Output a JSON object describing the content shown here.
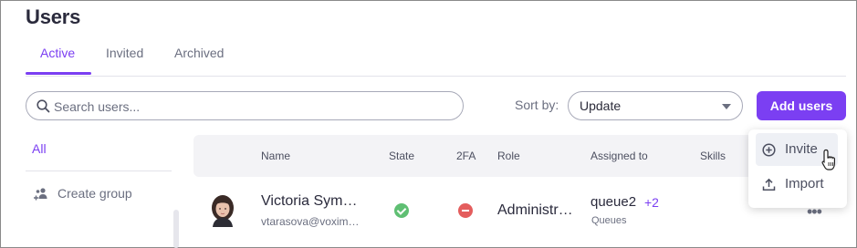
{
  "page": {
    "title": "Users"
  },
  "tabs": [
    {
      "label": "Active",
      "active": true
    },
    {
      "label": "Invited",
      "active": false
    },
    {
      "label": "Archived",
      "active": false
    }
  ],
  "toolbar": {
    "search_placeholder": "Search users...",
    "sort_label": "Sort by:",
    "sort_value": "Update",
    "add_label": "Add users"
  },
  "sidebar": {
    "all_label": "All",
    "create_group_label": "Create group"
  },
  "table": {
    "columns": [
      "Name",
      "State",
      "2FA",
      "Role",
      "Assigned to",
      "Skills"
    ],
    "rows": [
      {
        "name": "Victoria Sym…",
        "email": "vtarasova@voxim…",
        "state_icon": "check-circle-icon",
        "twofa_icon": "minus-circle-icon",
        "role": "Administr…",
        "assigned_to": "queue2",
        "assigned_more": "+2",
        "assigned_sub": "Queues",
        "actions_label": "•••"
      }
    ]
  },
  "dropdown_menu": {
    "items": [
      {
        "label": "Invite",
        "icon": "plus-circle-icon"
      },
      {
        "label": "Import",
        "icon": "upload-icon"
      }
    ]
  },
  "colors": {
    "accent": "#7b3ff2",
    "success": "#5fbf73",
    "danger": "#e45d5d",
    "header_bg": "#f3f3f6"
  }
}
